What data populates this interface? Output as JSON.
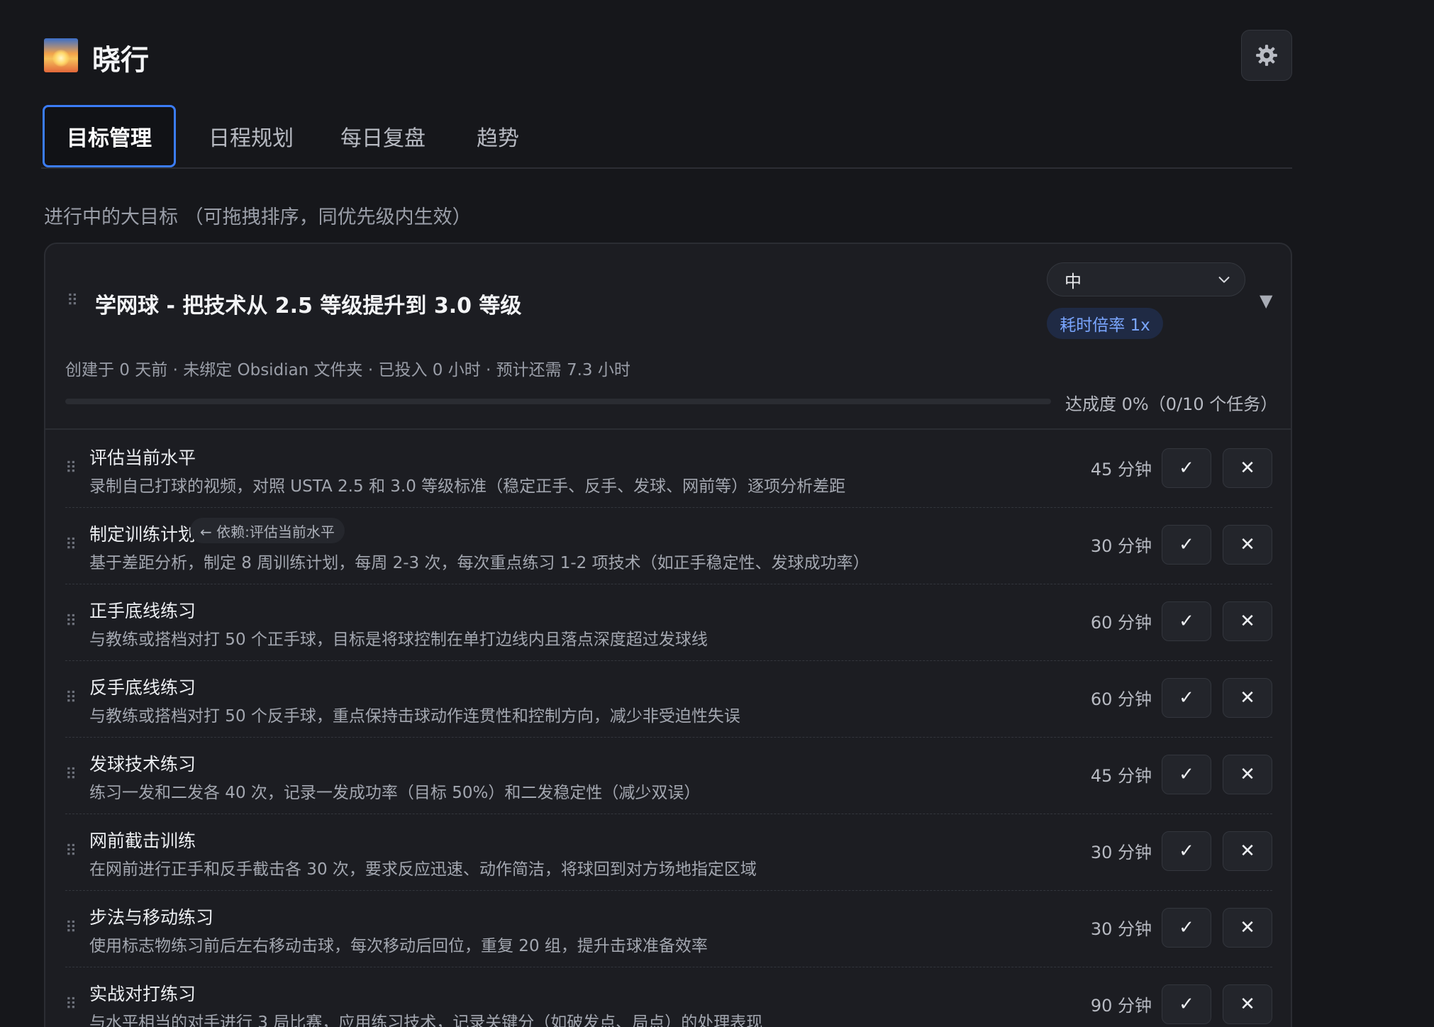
{
  "app": {
    "title": "晓行",
    "logo_icon": "sunrise-icon",
    "settings_icon": "gear-icon"
  },
  "tabs": [
    {
      "label": "目标管理",
      "active": true
    },
    {
      "label": "日程规划",
      "active": false
    },
    {
      "label": "每日复盘",
      "active": false
    },
    {
      "label": "趋势",
      "active": false
    }
  ],
  "section_label": "进行中的大目标 （可拖拽排序，同优先级内生效）",
  "goal": {
    "title": "学网球 - 把技术从 2.5 等级提升到 3.0 等级",
    "priority": "中",
    "rate_badge": "耗时倍率 1x",
    "collapse_symbol": "▼",
    "meta": "创建于 0 天前 · 未绑定 Obsidian 文件夹 · 已投入 0 小时 · 预计还需 7.3 小时",
    "progress": 0,
    "progress_text": "达成度 0%（0/10 个任务）",
    "accent": "#3b7cf6"
  },
  "tasks": [
    {
      "name": "评估当前水平",
      "dependency": "",
      "desc": "录制自己打球的视频，对照 USTA 2.5 和 3.0 等级标准（稳定正手、反手、发球、网前等）逐项分析差距",
      "duration": "45 分钟"
    },
    {
      "name": "制定训练计划",
      "dependency": "← 依赖:评估当前水平",
      "desc": "基于差距分析，制定 8 周训练计划，每周 2-3 次，每次重点练习 1-2 项技术（如正手稳定性、发球成功率）",
      "duration": "30 分钟"
    },
    {
      "name": "正手底线练习",
      "dependency": "",
      "desc": "与教练或搭档对打 50 个正手球，目标是将球控制在单打边线内且落点深度超过发球线",
      "duration": "60 分钟"
    },
    {
      "name": "反手底线练习",
      "dependency": "",
      "desc": "与教练或搭档对打 50 个反手球，重点保持击球动作连贯性和控制方向，减少非受迫性失误",
      "duration": "60 分钟"
    },
    {
      "name": "发球技术练习",
      "dependency": "",
      "desc": "练习一发和二发各 40 次，记录一发成功率（目标 50%）和二发稳定性（减少双误）",
      "duration": "45 分钟"
    },
    {
      "name": "网前截击训练",
      "dependency": "",
      "desc": "在网前进行正手和反手截击各 30 次，要求反应迅速、动作简洁，将球回到对方场地指定区域",
      "duration": "30 分钟"
    },
    {
      "name": "步法与移动练习",
      "dependency": "",
      "desc": "使用标志物练习前后左右移动击球，每次移动后回位，重复 20 组，提升击球准备效率",
      "duration": "30 分钟"
    },
    {
      "name": "实战对打练习",
      "dependency": "",
      "desc": "与水平相当的对手进行 3 局比赛，应用练习技术，记录关键分（如破发点、局点）的处理表现",
      "duration": "90 分钟"
    }
  ],
  "task_actions": {
    "done_symbol": "✓",
    "delete_symbol": "✕"
  }
}
